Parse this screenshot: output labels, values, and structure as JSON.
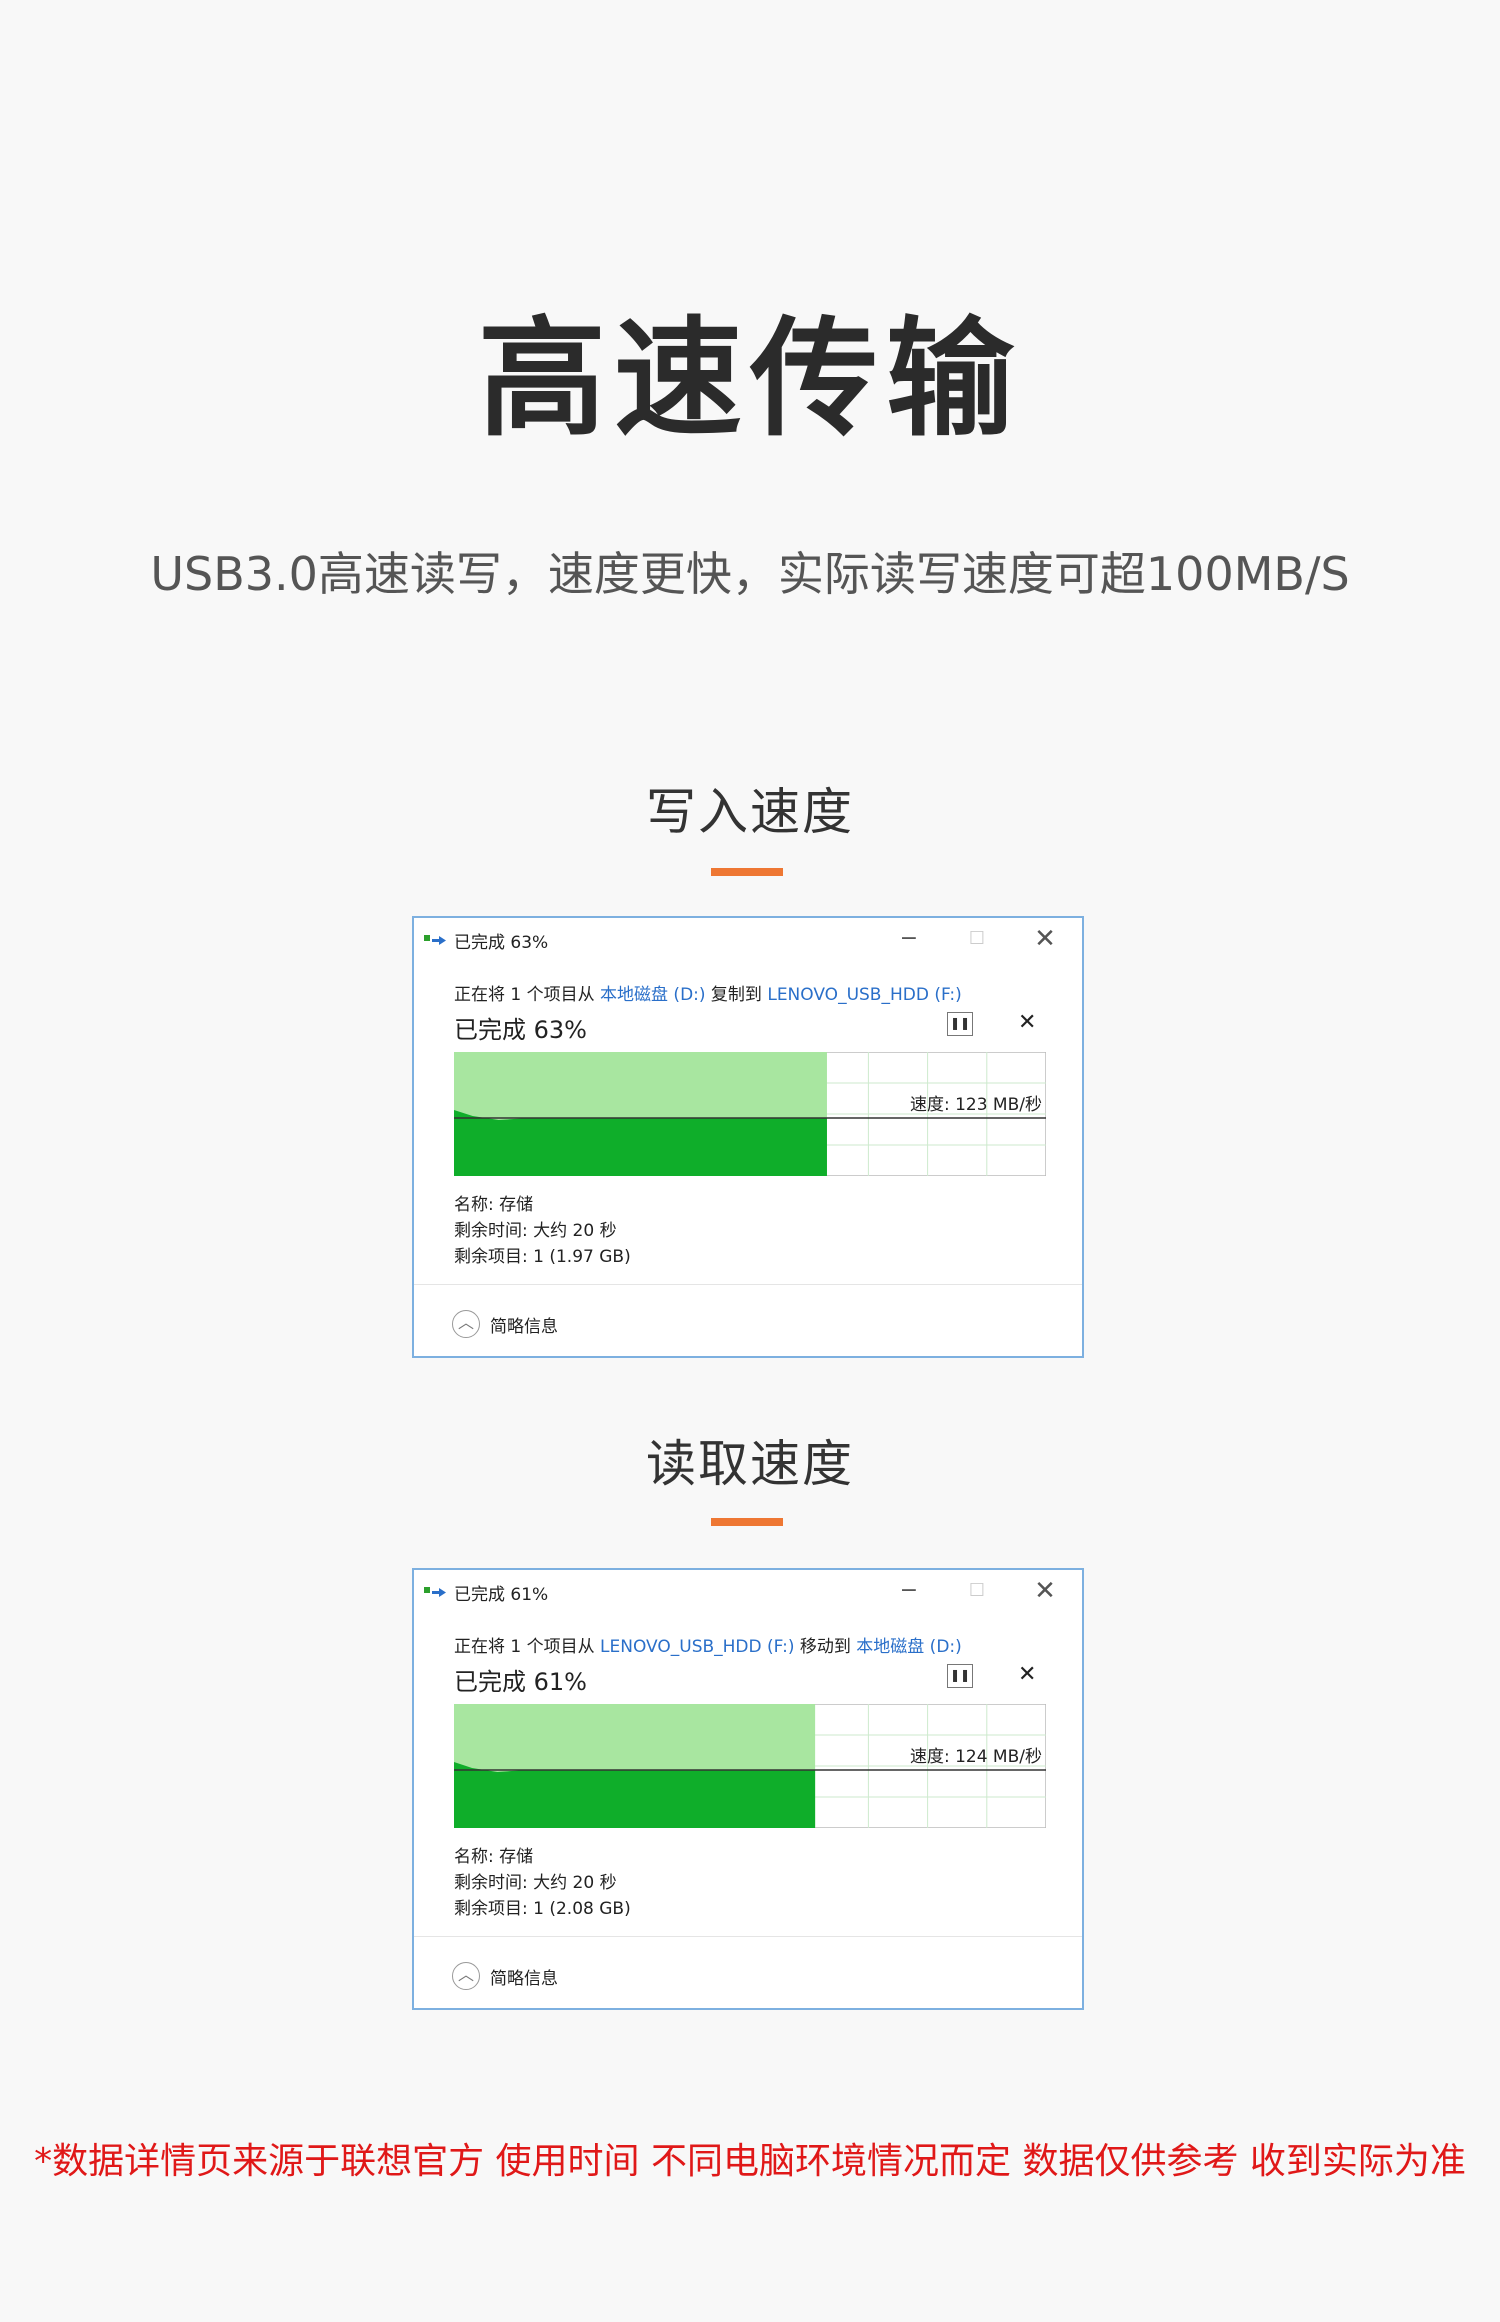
{
  "header": {
    "title": "高速传输",
    "subtitle": "USB3.0高速读写，速度更快，实际读写速度可超100MB/S"
  },
  "colors": {
    "accent": "#ee7733",
    "link": "#2a6fc9",
    "graph_fill_light": "#a8e6a0",
    "graph_fill_dark": "#0fae2a",
    "disclaimer": "#e01818"
  },
  "sections": [
    {
      "title": "写入速度",
      "dialog": {
        "title": "已完成 63%",
        "desc_prefix": "正在将 1 个项目从 ",
        "source": "本地磁盘 (D:)",
        "desc_mid": " 复制到 ",
        "dest": "LENOVO_USB_HDD (F:)",
        "progress_text": "已完成 63%",
        "progress_fraction": 0.63,
        "speed_label": "速度: 123 MB/秒",
        "name_label": "名称: 存储",
        "time_left": "剩余时间: 大约 20 秒",
        "items_left": "剩余项目: 1 (1.97 GB)",
        "more_info": "简略信息"
      }
    },
    {
      "title": "读取速度",
      "dialog": {
        "title": "已完成 61%",
        "desc_prefix": "正在将 1 个项目从 ",
        "source": "LENOVO_USB_HDD (F:)",
        "desc_mid": " 移动到 ",
        "dest": "本地磁盘 (D:)",
        "progress_text": "已完成 61%",
        "progress_fraction": 0.61,
        "speed_label": "速度: 124 MB/秒",
        "name_label": "名称: 存储",
        "time_left": "剩余时间: 大约 20 秒",
        "items_left": "剩余项目: 1 (2.08 GB)",
        "more_info": "简略信息"
      }
    }
  ],
  "footer": {
    "disclaimer": "*数据详情页来源于联想官方 使用时间 不同电脑环境情况而定 数据仅供参考 收到实际为准"
  }
}
